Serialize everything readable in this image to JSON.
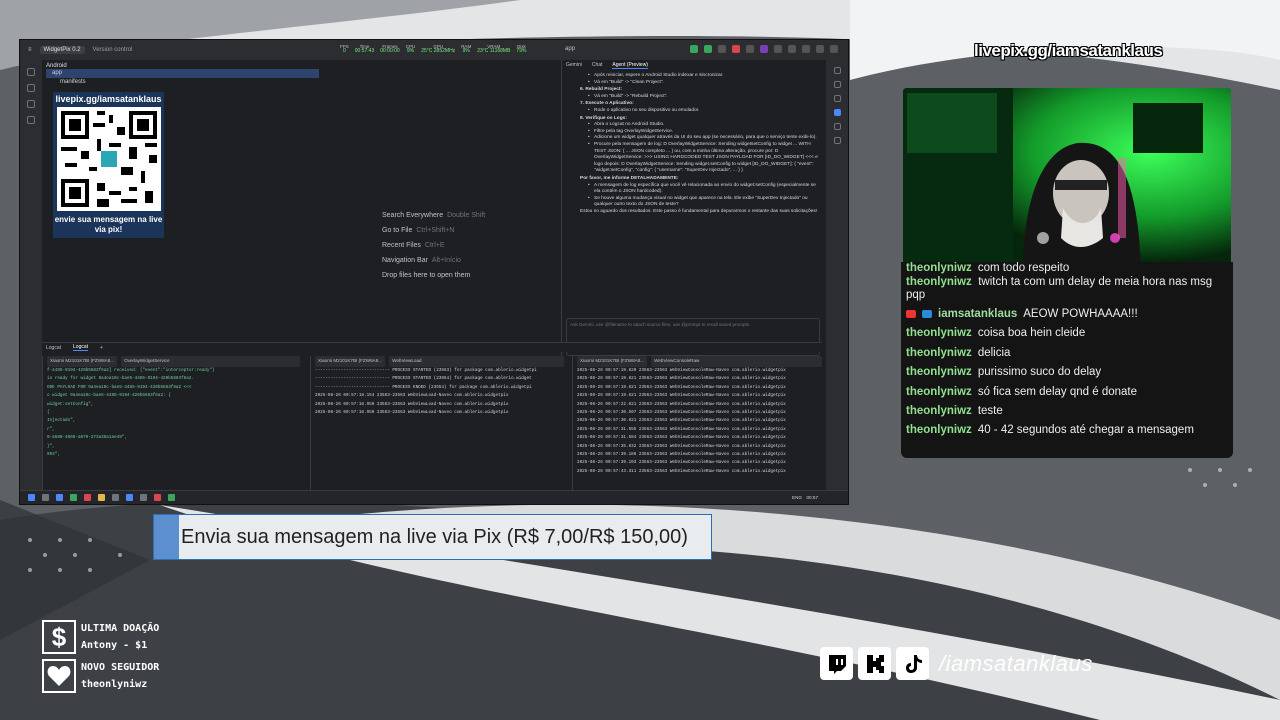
{
  "overlay": {
    "live_url": "livepix.gg/iamsatanklaus",
    "pix_banner": "Envia sua mensagem na live via Pix (R$ 7,00/R$ 150,00)",
    "last_donation": {
      "title": "ULTIMA DOAÇÃO",
      "value": "Antony - $1"
    },
    "new_follower": {
      "title": "NOVO SEGUIDOR",
      "value": "theonlyniwz"
    },
    "social_handle": "/iamsatanklaus"
  },
  "chat": {
    "messages": [
      {
        "user": "theonlyniwz",
        "text": "com todo respeito"
      },
      {
        "user": "theonlyniwz",
        "text": "twitch ta com um delay de meia hora nas msg pqp"
      },
      {
        "user": "iamsatanklaus",
        "text": "AEOW POWHAAAA!!!"
      },
      {
        "user": "theonlyniwz",
        "text": "coisa boa hein cleide"
      },
      {
        "user": "theonlyniwz",
        "text": "delicia"
      },
      {
        "user": "theonlyniwz",
        "text": "purissimo suco do delay"
      },
      {
        "user": "theonlyniwz",
        "text": "só fica sem delay qnd é donate"
      },
      {
        "user": "theonlyniwz",
        "text": "teste"
      },
      {
        "user": "theonlyniwz",
        "text": "40 - 42 segundos até chegar a mensagem"
      }
    ]
  },
  "ide": {
    "project": "WidgetPix 0.2",
    "version_control": "Version control",
    "metrics": [
      {
        "label": "FPS",
        "value": "0"
      },
      {
        "label": "Time",
        "value": "00:57:43"
      },
      {
        "label": "Frames",
        "value": "00:00:00"
      },
      {
        "label": "CPU",
        "value": "9%"
      },
      {
        "label": "GPU",
        "value": "25°C 2852MHz"
      },
      {
        "label": "RAM",
        "value": "9%"
      },
      {
        "label": "VRAM",
        "value": "23°C 11168MB"
      },
      {
        "label": "Disk",
        "value": "79%"
      }
    ],
    "run_config": "app",
    "project_panel": {
      "header": "Android",
      "rows": [
        "app",
        "manifests"
      ]
    },
    "qr_card": {
      "title": "livepix.gg/iamsatanklaus",
      "caption": "envie sua mensagem na live via pix!"
    },
    "editor_hints": [
      {
        "label": "Search Everywhere",
        "key": "Double Shift"
      },
      {
        "label": "Go to File",
        "key": "Ctrl+Shift+N"
      },
      {
        "label": "Recent Files",
        "key": "Ctrl+E"
      },
      {
        "label": "Navigation Bar",
        "key": "Alt+Início"
      },
      {
        "label": "Drop files here to open them",
        "key": ""
      }
    ],
    "gemini": {
      "tabs": [
        "Gemini",
        "Chat",
        "Agent (Preview)"
      ],
      "lines": [
        {
          "type": "bul",
          "text": "Após reiniciar, espere o Android Studio indexar e sincronizar."
        },
        {
          "type": "bul",
          "text": "Vá em \"Build\" -> \"Clean Project\"."
        },
        {
          "type": "step",
          "text": "6.  Rebuild Project:"
        },
        {
          "type": "bul",
          "text": "Vá em \"Build\" -> \"Rebuild Project\"."
        },
        {
          "type": "step",
          "text": "7.  Execute o Aplicativo:"
        },
        {
          "type": "bul",
          "text": "Rode o aplicativo no seu dispositivo ou emulador."
        },
        {
          "type": "step",
          "text": "8.  Verifique os Logs:"
        },
        {
          "type": "bul",
          "text": "Abra o Logcat no Android Studio."
        },
        {
          "type": "bul",
          "text": "Filtre pela tag OverlayWidgetService."
        },
        {
          "type": "bul",
          "text": "Adicione um widget qualquer através da UI do seu app (se necessário, para que o serviço tente exibi-lo)."
        },
        {
          "type": "bul",
          "text": "Procure pela mensagem de log: D OverlayWidgetService: Sending widgetsetConfig to widget ... WITH TEST JSON: { ... JSON completo ... } ou, com a minha última alteração, procure por: D OverlayWidgetService: >>> USING HARDCODED TEST JSON PAYLOAD FOR [ID_DO_WIDGET] <<< e logo depois: D OverlayWidgetService: Sending widget.setConfig to widget [ID_DO_WIDGET]: { \"event\": \"widget:setConfig\", \"config\": { \"username\": \"SuperDev Injectado\", ... } }"
        },
        {
          "type": "step",
          "text": "Por favor, me informe DETALHADAMENTE:"
        },
        {
          "type": "bul",
          "text": "A mensagem de log específica que você vê relacionada ao envio do widget:setConfig (especialmente se ela contém o JSON hardcoded)."
        },
        {
          "type": "bul",
          "text": "Se houve alguma mudança visual no widget que aparece na tela. Ele exibe \"SuperDev Injectado\" ou qualquer outro texto do JSON de teste?"
        },
        {
          "type": "plain",
          "text": "Estou no aguardo dos resultados. Este passo é fundamental para depurarmos o restante das suas solicitações!"
        }
      ],
      "input_placeholder": "Ask Gemini, use @filename to attach source files, use @prompt to recall saved prompts",
      "context_label": "Current file",
      "model_label": "Default Model"
    },
    "logcat": {
      "tabs": [
        "Logcat",
        "Logcat"
      ],
      "panels": [
        {
          "device": "Xiaomi M2101K7BI (FZW8A8...",
          "filter": "OverlayWidgetService",
          "lines": [
            "f-4485-9194-420b5683f6a2] received: {\"event\":\"interceptor:ready\"}",
            "is ready for widget 9a4ea10c-bae5-4485-9194-420b5683f6a2.",
            "ODE PAYLOAD FOR 9a4ea10c-bae5-4485-9194-420b5683f6a2 <<<",
            "o widget 9a4ea10c-bae5-4485-9194-420b5683f6a2: {",
            "widget:setConfig\",",
            "{",
            "Injectado\",",
            "r\",",
            "0-a580-4066-a079-273a35a1ae49\",",
            "",
            "}\",",
            "993\","
          ]
        },
        {
          "device": "Xiaomi M2101K7BI (FZW8A8...",
          "filter": "WebViewLoad",
          "lines": [
            "----------------------------- PROCESS STARTED (23563) for package com.ablerio.widgetpi",
            "----------------------------- PROCESS STARTED (23654) for package com.ablerio.widget",
            "----------------------------- PROCESS ENDED (23654) for package com.ablerio.widgetpi",
            "2025-08-26 00:57:18.154 23563-23563 WebViewLoad-Naveo    com.ablerio.widgetpix",
            "2025-08-26 00:57:18.950 23563-23563 WebViewLoad-Naveo    com.ablerio.widgetpix",
            "2025-08-26 00:57:18.950 23563-23563 WebViewLoad-Naveo    com.ablerio.widgetpix"
          ]
        },
        {
          "device": "Xiaomi M2101K7BI (FZW8A8...",
          "filter": "WebViewConsoleRaw",
          "lines": [
            "2025-08-26 00:57:19.620 23563-23563 WebViewConsoleRaw-Naveo com.ablerio.widgetpix",
            "2025-08-26 00:57:19.621 23563-23563 WebViewConsoleRaw-Naveo com.ablerio.widgetpix",
            "2025-08-26 00:57:19.621 23563-23563 WebViewConsoleRaw-Naveo com.ablerio.widgetpix",
            "2025-08-26 00:57:19.621 23563-23563 WebViewConsoleRaw-Naveo com.ablerio.widgetpix",
            "2025-08-26 00:57:22.621 23563-23563 WebViewConsoleRaw-Naveo com.ablerio.widgetpix",
            "2025-08-26 00:57:30.597 23563-23563 WebViewConsoleRaw-Naveo com.ablerio.widgetpix",
            "2025-08-26 00:57:30.621 23563-23563 WebViewConsoleRaw-Naveo com.ablerio.widgetpix",
            "2025-08-26 00:57:31.555 23563-23563 WebViewConsoleRaw-Naveo com.ablerio.widgetpix",
            "2025-08-26 00:57:31.584 23563-23563 WebViewConsoleRaw-Naveo com.ablerio.widgetpix",
            "2025-08-26 00:57:35.832 23563-23563 WebViewConsoleRaw-Naveo com.ablerio.widgetpix",
            "2025-08-26 00:57:39.186 23563-23563 WebViewConsoleRaw-Naveo com.ablerio.widgetpix",
            "2025-08-26 00:57:39.193 23563-23563 WebViewConsoleRaw-Naveo com.ablerio.widgetpix",
            "2025-08-26 00:57:43.311 23563-23563 WebViewConsoleRaw-Naveo com.ablerio.widgetpix"
          ]
        }
      ]
    },
    "taskbar": {
      "lang": "ENG",
      "time": "00:57"
    }
  },
  "colors": {
    "chat_user": "#8fe08f",
    "banner_stripe": "#5b8fd0",
    "ide_bg": "#1e1f22"
  }
}
